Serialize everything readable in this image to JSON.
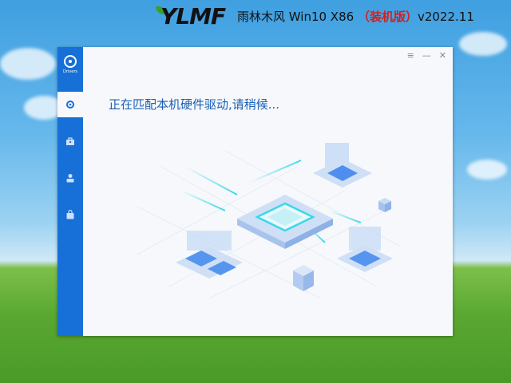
{
  "brand": {
    "logo_text": "YLMF",
    "title_main": "雨林木风  Win10 X86 ",
    "title_edition": "（装机版）",
    "title_version": "v2022.11"
  },
  "window": {
    "controls": {
      "menu": "≡",
      "minimize": "—",
      "close": "✕"
    },
    "sidebar": {
      "logo_label": "Drivers",
      "items": [
        {
          "icon": "gear-icon",
          "active": true
        },
        {
          "icon": "toolbox-icon",
          "active": false
        },
        {
          "icon": "user-icon",
          "active": false
        },
        {
          "icon": "bag-icon",
          "active": false
        }
      ]
    },
    "status_text": "正在匹配本机硬件驱动,请稍候..."
  },
  "colors": {
    "sidebar": "#1670d8",
    "status_text": "#1a5fb4",
    "edition_red": "#d12020",
    "chip_cyan": "#3ad8e6"
  }
}
